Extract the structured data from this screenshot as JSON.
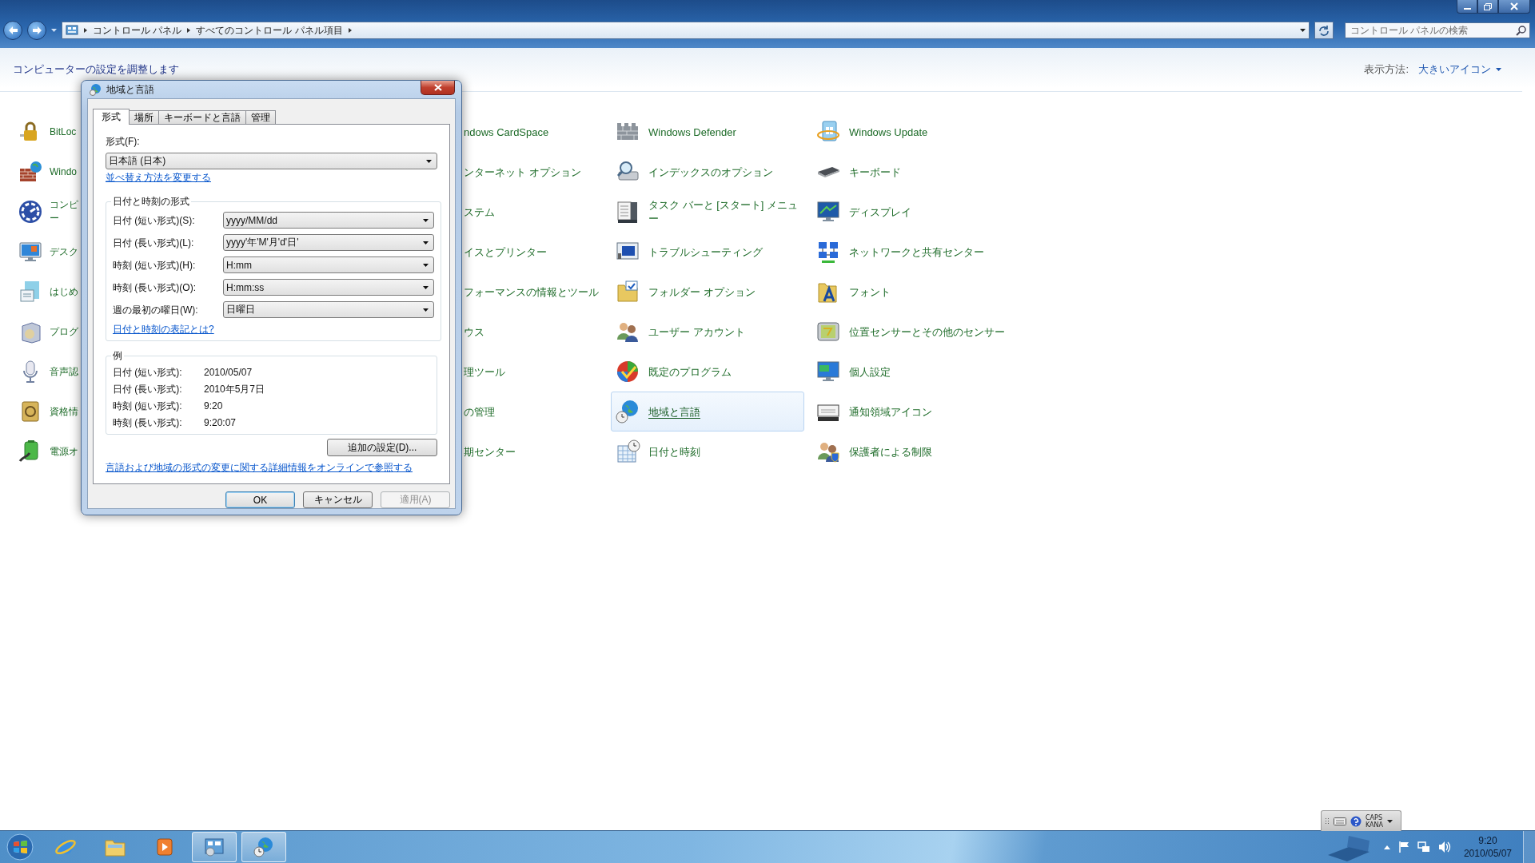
{
  "window": {
    "breadcrumb": [
      "コントロール パネル",
      "すべてのコントロール パネル項目"
    ],
    "search": {
      "placeholder": "コントロール パネルの検索"
    }
  },
  "header": {
    "title": "コンピューターの設定を調整します",
    "view_label": "表示方法:",
    "view_value": "大きいアイコン"
  },
  "columns": [
    {
      "kind": "icons",
      "items": [
        {
          "lines": [
            "BitLoc"
          ],
          "selected": false
        },
        {
          "lines": [
            "Windo"
          ],
          "selected": false
        },
        {
          "lines": [
            "コンピ",
            "ー"
          ],
          "selected": false
        },
        {
          "lines": [
            "デスク"
          ],
          "selected": false
        },
        {
          "lines": [
            "はじめ"
          ],
          "selected": false
        },
        {
          "lines": [
            "プログ"
          ],
          "selected": false
        },
        {
          "lines": [
            "音声認"
          ],
          "selected": false
        },
        {
          "lines": [
            "資格情"
          ],
          "selected": false
        },
        {
          "lines": [
            "電源オ"
          ],
          "selected": false
        }
      ]
    },
    {
      "kind": "text",
      "items": [
        {
          "lines": [
            "ndows CardSpace"
          ],
          "selected": false
        },
        {
          "lines": [
            "ンターネット オプション"
          ],
          "selected": false
        },
        {
          "lines": [
            "ステム"
          ],
          "selected": false
        },
        {
          "lines": [
            "イスとプリンター"
          ],
          "selected": false
        },
        {
          "lines": [
            "フォーマンスの情報とツール"
          ],
          "selected": false
        },
        {
          "lines": [
            "ウス"
          ],
          "selected": false
        },
        {
          "lines": [
            "理ツール"
          ],
          "selected": false
        },
        {
          "lines": [
            "の管理"
          ],
          "selected": false
        },
        {
          "lines": [
            "期センター"
          ],
          "selected": false
        }
      ]
    },
    {
      "kind": "icons",
      "items": [
        {
          "lines": [
            "Windows Defender"
          ],
          "selected": false
        },
        {
          "lines": [
            "インデックスのオプション"
          ],
          "selected": false
        },
        {
          "lines": [
            "タスク バーと [スタート] メニュ",
            "ー"
          ],
          "selected": false
        },
        {
          "lines": [
            "トラブルシューティング"
          ],
          "selected": false
        },
        {
          "lines": [
            "フォルダー オプション"
          ],
          "selected": false
        },
        {
          "lines": [
            "ユーザー アカウント"
          ],
          "selected": false
        },
        {
          "lines": [
            "既定のプログラム"
          ],
          "selected": false
        },
        {
          "lines": [
            "地域と言語"
          ],
          "selected": true
        },
        {
          "lines": [
            "日付と時刻"
          ],
          "selected": false
        }
      ]
    },
    {
      "kind": "icons",
      "items": [
        {
          "lines": [
            "Windows Update"
          ],
          "selected": false
        },
        {
          "lines": [
            "キーボード"
          ],
          "selected": false
        },
        {
          "lines": [
            "ディスプレイ"
          ],
          "selected": false
        },
        {
          "lines": [
            "ネットワークと共有センター"
          ],
          "selected": false
        },
        {
          "lines": [
            "フォント"
          ],
          "selected": false
        },
        {
          "lines": [
            "位置センサーとその他のセンサー"
          ],
          "selected": false
        },
        {
          "lines": [
            "個人設定"
          ],
          "selected": false
        },
        {
          "lines": [
            "通知領域アイコン"
          ],
          "selected": false
        },
        {
          "lines": [
            "保護者による制限"
          ],
          "selected": false
        }
      ]
    }
  ],
  "dialog": {
    "title": "地域と言語",
    "tabs": [
      {
        "label": "形式",
        "selected": true
      },
      {
        "label": "場所",
        "selected": false
      },
      {
        "label": "キーボードと言語",
        "selected": false
      },
      {
        "label": "管理",
        "selected": false
      }
    ],
    "format_label": "形式(F):",
    "format_value": "日本語 (日本)",
    "sort_link": "並べ替え方法を変更する",
    "datetime_group": {
      "title": "日付と時刻の形式",
      "rows": [
        {
          "label": "日付 (短い形式)(S):",
          "value": "yyyy/MM/dd"
        },
        {
          "label": "日付 (長い形式)(L):",
          "value": "yyyy'年'M'月'd'日'"
        },
        {
          "label": "時刻 (短い形式)(H):",
          "value": "H:mm"
        },
        {
          "label": "時刻 (長い形式)(O):",
          "value": "H:mm:ss"
        },
        {
          "label": "週の最初の曜日(W):",
          "value": "日曜日"
        }
      ],
      "link": "日付と時刻の表記とは?"
    },
    "example_group": {
      "title": "例",
      "rows": [
        {
          "label": "日付 (短い形式):",
          "value": "2010/05/07"
        },
        {
          "label": "日付 (長い形式):",
          "value": "2010年5月7日"
        },
        {
          "label": "時刻 (短い形式):",
          "value": "9:20"
        },
        {
          "label": "時刻 (長い形式):",
          "value": "9:20:07"
        }
      ]
    },
    "additional_button": "追加の設定(D)...",
    "online_link": "言語および地域の形式の変更に関する詳細情報をオンラインで参照する",
    "buttons": [
      {
        "label": "OK",
        "kind": "default",
        "disabled": false
      },
      {
        "label": "キャンセル",
        "kind": "normal",
        "disabled": false
      },
      {
        "label": "適用(A)",
        "kind": "normal",
        "disabled": true
      }
    ]
  },
  "taskbar": {
    "apps": [
      {
        "running": false
      },
      {
        "running": false
      },
      {
        "running": false
      },
      {
        "running": true
      },
      {
        "running": true
      }
    ],
    "clock": {
      "time": "9:20",
      "date": "2010/05/07"
    }
  },
  "language_bar": {
    "caps": "CAPS",
    "kana": "KANA"
  }
}
